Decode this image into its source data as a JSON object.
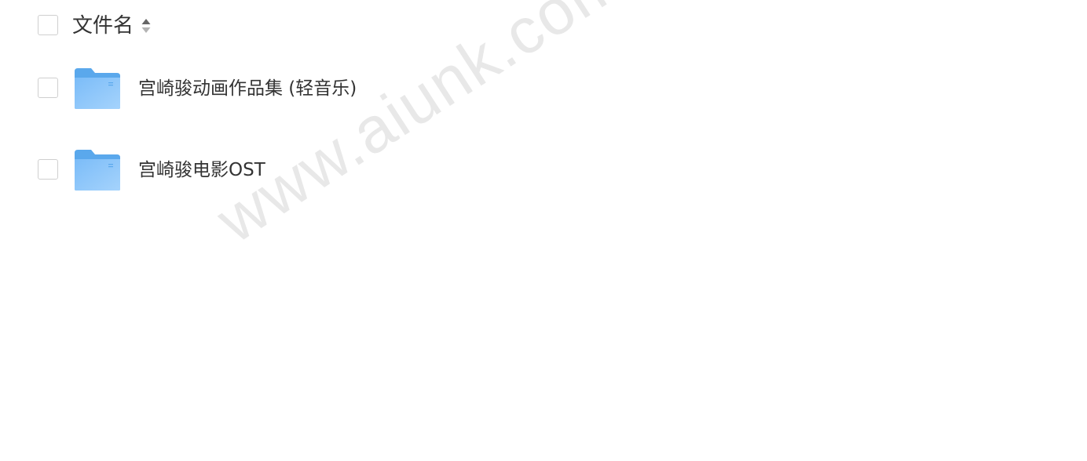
{
  "header": {
    "column_label": "文件名",
    "sort_icon": "sort-icon"
  },
  "files": [
    {
      "name": "宫崎骏动画作品集 (轻音乐)",
      "icon": "folder-icon"
    },
    {
      "name": "宫崎骏电影OST",
      "icon": "folder-icon"
    }
  ],
  "watermark": "www.aiunk.com",
  "colors": {
    "folder_back": "#5aa8ec",
    "folder_front": "#8ec9fb",
    "text": "#333333",
    "checkbox_border": "#cfcfcf",
    "watermark": "#e8e8e8"
  }
}
